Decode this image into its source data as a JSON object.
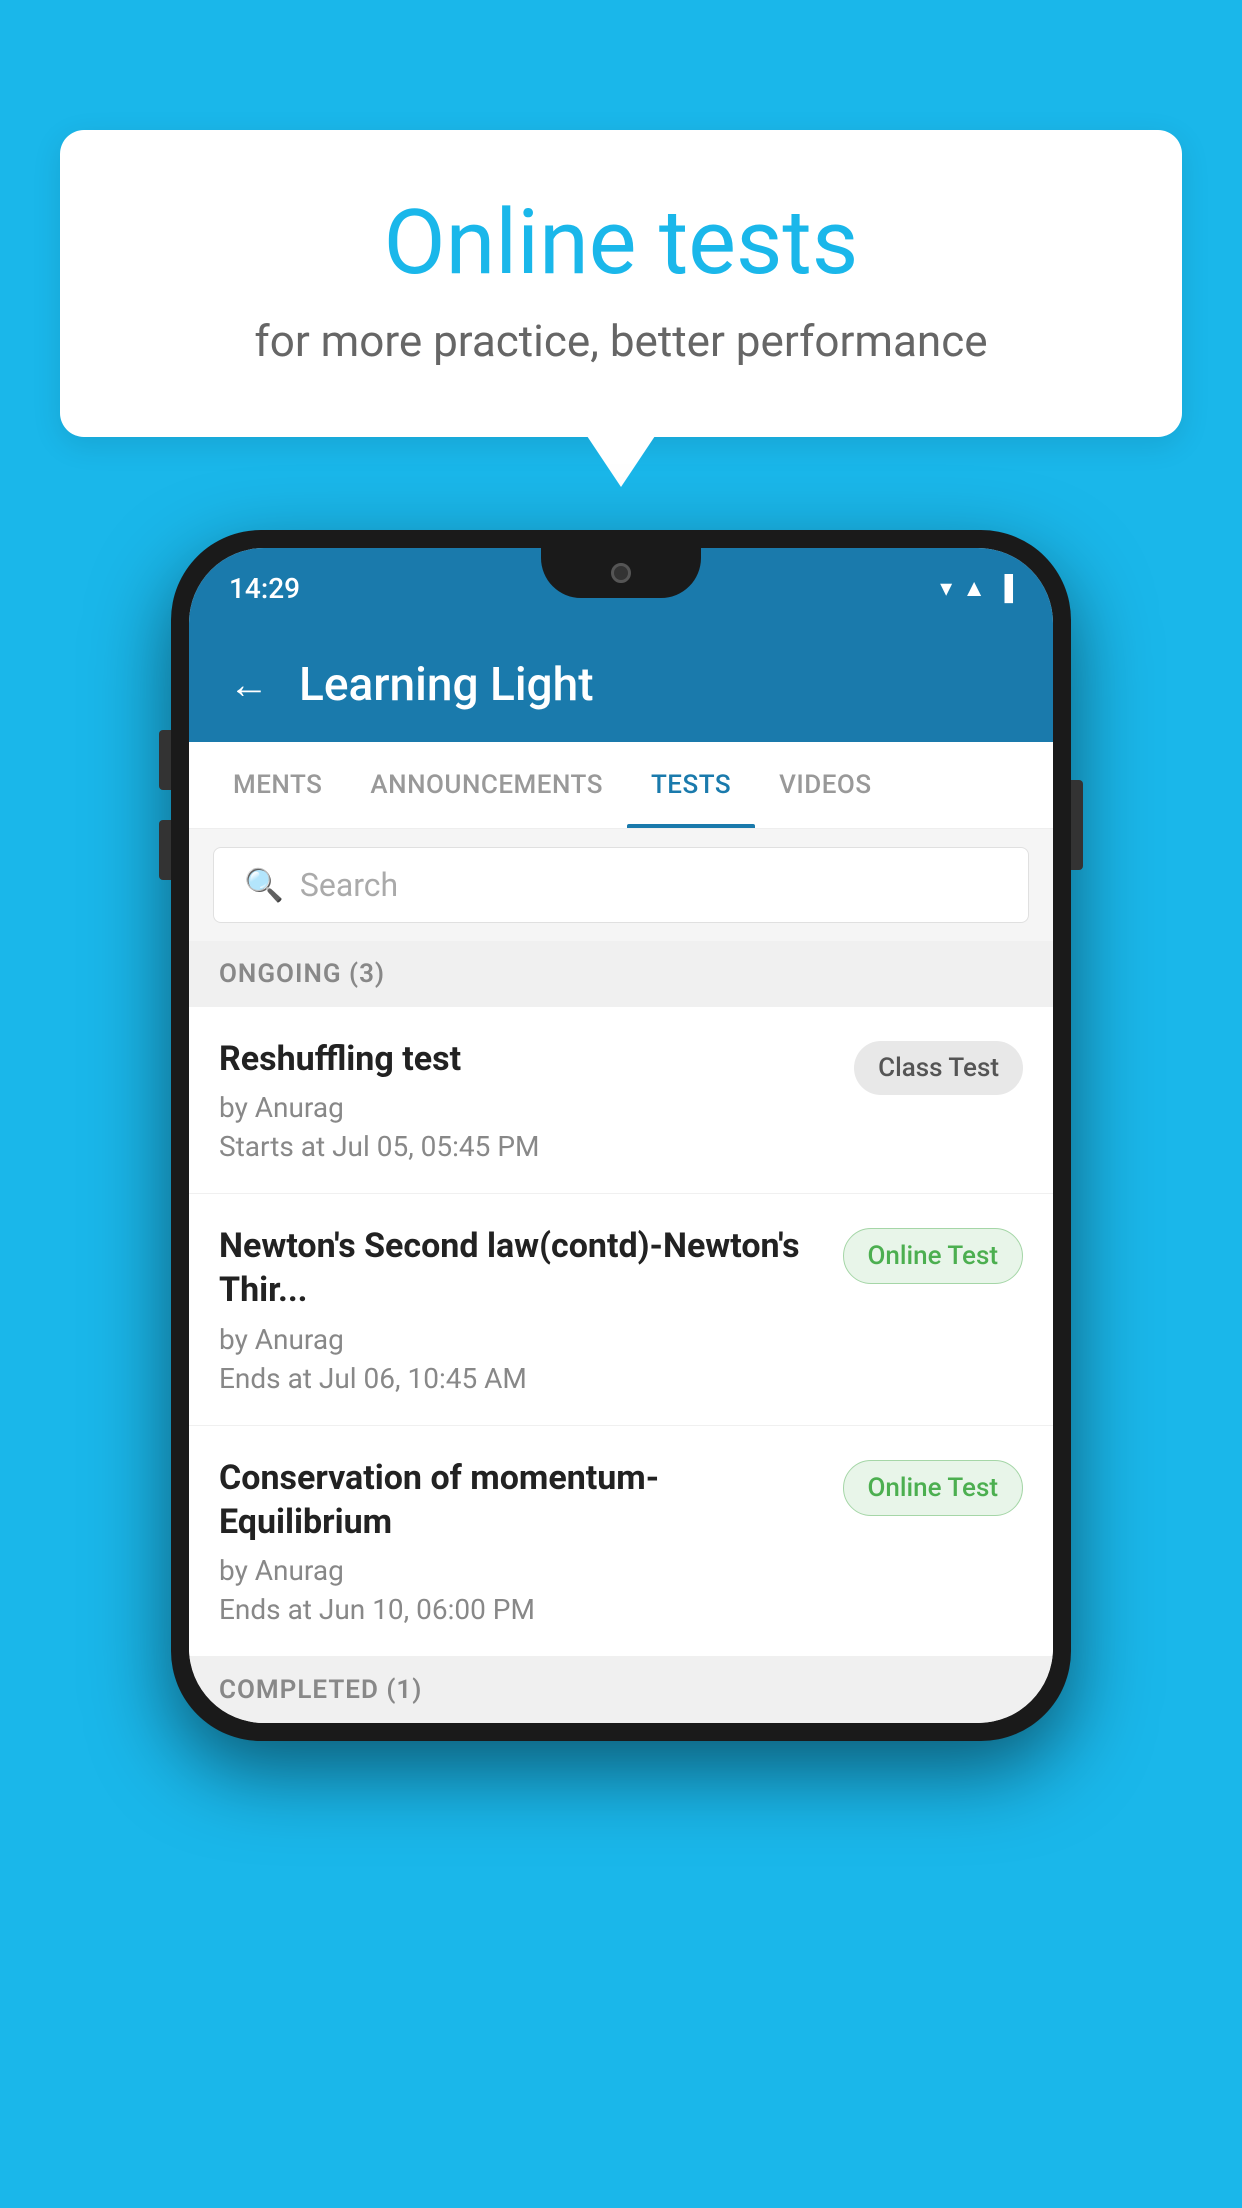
{
  "background_color": "#1ab7ea",
  "speech_bubble": {
    "title": "Online tests",
    "subtitle": "for more practice, better performance"
  },
  "phone": {
    "status_bar": {
      "time": "14:29",
      "wifi": "▾",
      "signal": "▲",
      "battery": "▌"
    },
    "app_header": {
      "title": "Learning Light",
      "back_label": "←"
    },
    "tabs": [
      {
        "label": "MENTS",
        "active": false
      },
      {
        "label": "ANNOUNCEMENTS",
        "active": false
      },
      {
        "label": "TESTS",
        "active": true
      },
      {
        "label": "VIDEOS",
        "active": false
      }
    ],
    "search": {
      "placeholder": "Search"
    },
    "sections": [
      {
        "label": "ONGOING (3)",
        "items": [
          {
            "name": "Reshuffling test",
            "by": "by Anurag",
            "time": "Starts at  Jul 05, 05:45 PM",
            "badge": "Class Test",
            "badge_type": "class"
          },
          {
            "name": "Newton's Second law(contd)-Newton's Thir...",
            "by": "by Anurag",
            "time": "Ends at  Jul 06, 10:45 AM",
            "badge": "Online Test",
            "badge_type": "online"
          },
          {
            "name": "Conservation of momentum-Equilibrium",
            "by": "by Anurag",
            "time": "Ends at  Jun 10, 06:00 PM",
            "badge": "Online Test",
            "badge_type": "online"
          }
        ]
      }
    ],
    "completed_section_label": "COMPLETED (1)"
  }
}
